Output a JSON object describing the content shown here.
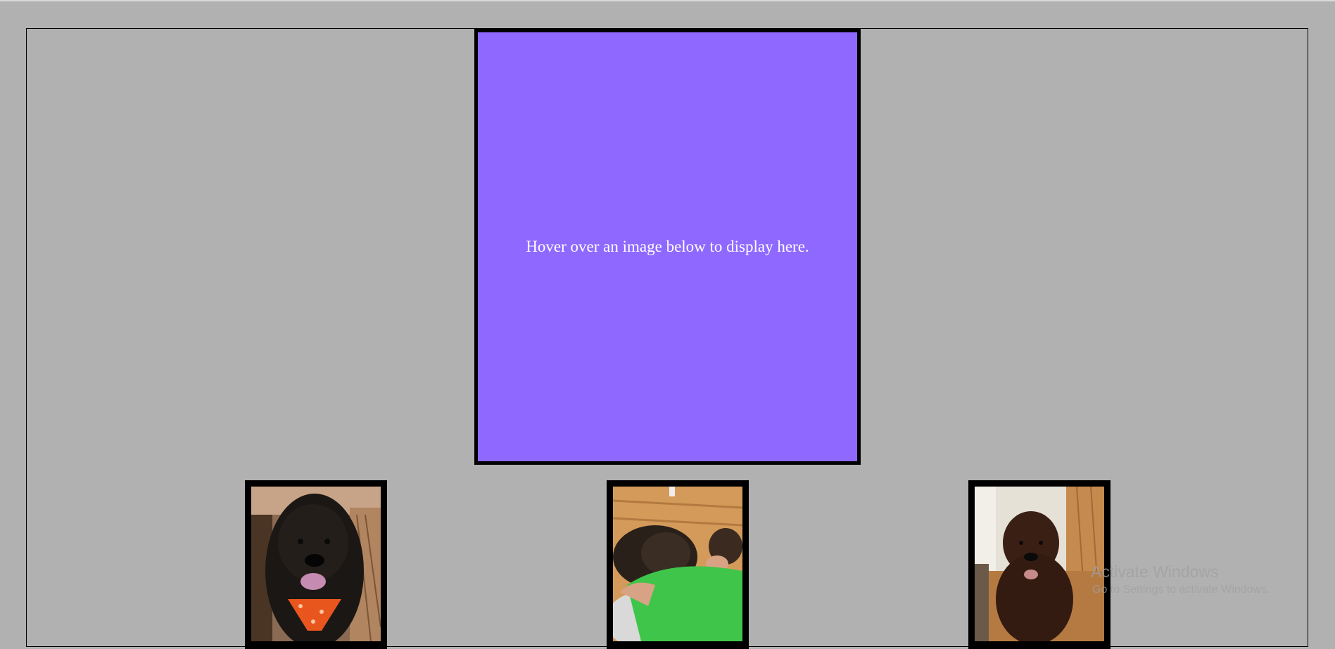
{
  "preview": {
    "text": "Hover over an image below to display here.",
    "background_color": "#8f69ff"
  },
  "thumbnails": [
    {
      "subject": "brown doodle dog with orange bandana"
    },
    {
      "subject": "child in green shirt hugging brown doodle dog"
    },
    {
      "subject": "brown doodle dog sitting on wood floor"
    }
  ],
  "watermark": {
    "title": "Activate Windows",
    "subtitle": "Go to Settings to activate Windows."
  },
  "colors": {
    "page_background": "#b1b1b1",
    "frame_border": "#000000",
    "thumb_border": "#000000"
  }
}
